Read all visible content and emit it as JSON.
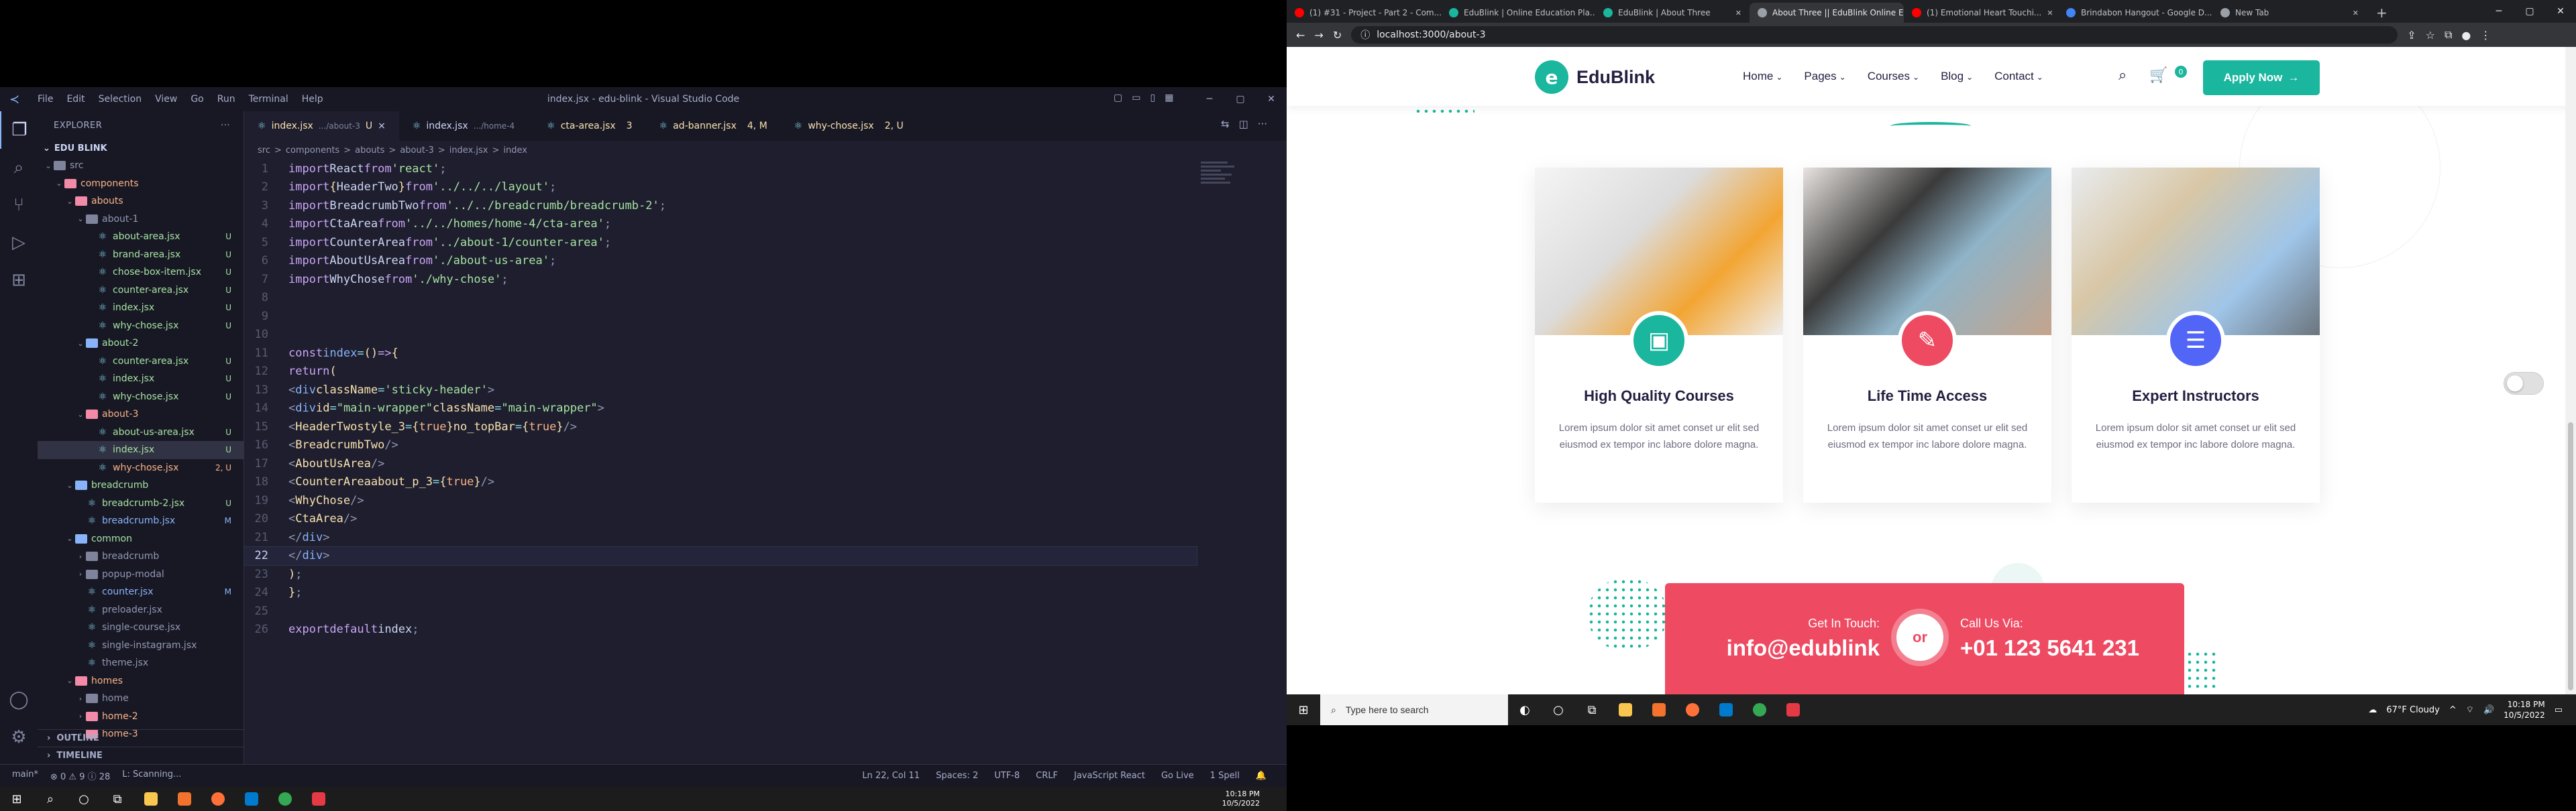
{
  "vscode": {
    "title": "index.jsx - edu-blink - Visual Studio Code",
    "menu": [
      "File",
      "Edit",
      "Selection",
      "View",
      "Go",
      "Run",
      "Terminal",
      "Help"
    ],
    "explorer_label": "EXPLORER",
    "project": "EDU BLINK",
    "tree": [
      {
        "label": "src",
        "depth": 0,
        "type": "folder",
        "open": true,
        "badge": "",
        "color": "c-grey"
      },
      {
        "label": "components",
        "depth": 1,
        "type": "folder",
        "open": true,
        "badge": "",
        "color": "c-orange"
      },
      {
        "label": "abouts",
        "depth": 2,
        "type": "folder",
        "open": true,
        "badge": "",
        "color": "c-orange"
      },
      {
        "label": "about-1",
        "depth": 3,
        "type": "folder",
        "open": true,
        "badge": "",
        "color": "c-grey"
      },
      {
        "label": "about-area.jsx",
        "depth": 4,
        "type": "file",
        "badge": "U",
        "color": "c-green"
      },
      {
        "label": "brand-area.jsx",
        "depth": 4,
        "type": "file",
        "badge": "U",
        "color": "c-green"
      },
      {
        "label": "chose-box-item.jsx",
        "depth": 4,
        "type": "file",
        "badge": "U",
        "color": "c-green"
      },
      {
        "label": "counter-area.jsx",
        "depth": 4,
        "type": "file",
        "badge": "U",
        "color": "c-green"
      },
      {
        "label": "index.jsx",
        "depth": 4,
        "type": "file",
        "badge": "U",
        "color": "c-green"
      },
      {
        "label": "why-chose.jsx",
        "depth": 4,
        "type": "file",
        "badge": "U",
        "color": "c-green"
      },
      {
        "label": "about-2",
        "depth": 3,
        "type": "folder",
        "open": true,
        "badge": "",
        "color": "c-green"
      },
      {
        "label": "counter-area.jsx",
        "depth": 4,
        "type": "file",
        "badge": "U",
        "color": "c-green"
      },
      {
        "label": "index.jsx",
        "depth": 4,
        "type": "file",
        "badge": "U",
        "color": "c-green"
      },
      {
        "label": "why-chose.jsx",
        "depth": 4,
        "type": "file",
        "badge": "U",
        "color": "c-green"
      },
      {
        "label": "about-3",
        "depth": 3,
        "type": "folder",
        "open": true,
        "badge": "",
        "color": "c-orange"
      },
      {
        "label": "about-us-area.jsx",
        "depth": 4,
        "type": "file",
        "badge": "U",
        "color": "c-green"
      },
      {
        "label": "index.jsx",
        "depth": 4,
        "type": "file",
        "badge": "U",
        "color": "c-green",
        "selected": true
      },
      {
        "label": "why-chose.jsx",
        "depth": 4,
        "type": "file",
        "badge": "2, U",
        "color": "c-orange"
      },
      {
        "label": "breadcrumb",
        "depth": 2,
        "type": "folder",
        "open": true,
        "badge": "",
        "color": "c-green"
      },
      {
        "label": "breadcrumb-2.jsx",
        "depth": 3,
        "type": "file",
        "badge": "U",
        "color": "c-green"
      },
      {
        "label": "breadcrumb.jsx",
        "depth": 3,
        "type": "file",
        "badge": "M",
        "color": "c-blue"
      },
      {
        "label": "common",
        "depth": 2,
        "type": "folder",
        "open": true,
        "badge": "",
        "color": "c-green"
      },
      {
        "label": "breadcrumb",
        "depth": 3,
        "type": "folder",
        "open": false,
        "badge": "",
        "color": "c-grey"
      },
      {
        "label": "popup-modal",
        "depth": 3,
        "type": "folder",
        "open": false,
        "badge": "",
        "color": "c-grey"
      },
      {
        "label": "counter.jsx",
        "depth": 3,
        "type": "file",
        "badge": "M",
        "color": "c-blue"
      },
      {
        "label": "preloader.jsx",
        "depth": 3,
        "type": "file",
        "badge": "",
        "color": "c-grey"
      },
      {
        "label": "single-course.jsx",
        "depth": 3,
        "type": "file",
        "badge": "",
        "color": "c-grey"
      },
      {
        "label": "single-instagram.jsx",
        "depth": 3,
        "type": "file",
        "badge": "",
        "color": "c-grey"
      },
      {
        "label": "theme.jsx",
        "depth": 3,
        "type": "file",
        "badge": "",
        "color": "c-grey"
      },
      {
        "label": "homes",
        "depth": 2,
        "type": "folder",
        "open": true,
        "badge": "",
        "color": "c-orange"
      },
      {
        "label": "home",
        "depth": 3,
        "type": "folder",
        "open": false,
        "badge": "",
        "color": "c-grey"
      },
      {
        "label": "home-2",
        "depth": 3,
        "type": "folder",
        "open": false,
        "badge": "",
        "color": "c-orange"
      },
      {
        "label": "home-3",
        "depth": 3,
        "type": "folder",
        "open": false,
        "badge": "",
        "color": "c-orange"
      }
    ],
    "outline": "OUTLINE",
    "timeline": "TIMELINE",
    "tabs": [
      {
        "name": "index.jsx",
        "hint": ".../about-3",
        "badge": "U",
        "active": true
      },
      {
        "name": "index.jsx",
        "hint": ".../home-4",
        "badge": "",
        "active": false
      },
      {
        "name": "cta-area.jsx",
        "hint": "",
        "badge": "3",
        "active": false
      },
      {
        "name": "ad-banner.jsx",
        "hint": "",
        "badge": "4, M",
        "active": false
      },
      {
        "name": "why-chose.jsx",
        "hint": "",
        "badge": "2, U",
        "active": false
      }
    ],
    "breadcrumb": [
      "src",
      ">",
      "components",
      ">",
      "abouts",
      ">",
      "about-3",
      ">",
      "index.jsx",
      ">",
      "index"
    ],
    "status": {
      "branch": "main*",
      "sync": "⊗ 0 ⚠ 9 ⓘ 28",
      "scanning": "L: Scanning...",
      "position": "Ln 22, Col 11",
      "spaces": "Spaces: 2",
      "enc": "UTF-8",
      "eol": "CRLF",
      "lang": "JavaScript React",
      "golive": "Go Live",
      "spell": "1 Spell"
    }
  },
  "taskbar_left": {
    "time": "10:18 PM",
    "date": "10/5/2022"
  },
  "browser": {
    "tabs": [
      {
        "label": "(1) #31 - Project - Part 2 - Com...",
        "color": "#ff0000"
      },
      {
        "label": "EduBlink | Online Education Pla...",
        "color": "#1ab69d"
      },
      {
        "label": "EduBlink | About Three",
        "color": "#1ab69d"
      },
      {
        "label": "About Three || EduBlink Online E...",
        "color": "#9aa0a6",
        "active": true
      },
      {
        "label": "(1) Emotional Heart Touchi...",
        "color": "#ff0000"
      },
      {
        "label": "Brindabon Hangout - Google D...",
        "color": "#4285f4"
      },
      {
        "label": "New Tab",
        "color": "#9aa0a6"
      }
    ],
    "url": "localhost:3000/about-3"
  },
  "site": {
    "logo": "EduBlink",
    "nav": [
      "Home",
      "Pages",
      "Courses",
      "Blog",
      "Contact"
    ],
    "cart_count": "0",
    "apply": "Apply Now",
    "cards": [
      {
        "title": "High Quality Courses",
        "text": "Lorem ipsum dolor sit amet conset ur elit sed eiusmod ex tempor inc labore dolore magna.",
        "color": "#1ab69d",
        "icon": "monitor-icon"
      },
      {
        "title": "Life Time Access",
        "text": "Lorem ipsum dolor sit amet conset ur elit sed eiusmod ex tempor inc labore dolore magna.",
        "color": "#ee4a62",
        "icon": "certificate-icon"
      },
      {
        "title": "Expert Instructors",
        "text": "Lorem ipsum dolor sit amet conset ur elit sed eiusmod ex tempor inc labore dolore magna.",
        "color": "#5165f6",
        "icon": "instructor-icon"
      }
    ],
    "cta": {
      "labelA": "Get In Touch:",
      "valueA": "info@edublink",
      "or": "or",
      "labelB": "Call Us Via:",
      "valueB": "+01 123 5641 231"
    }
  },
  "taskbar_right": {
    "search": "Type here to search",
    "weather": "67°F  Cloudy",
    "time": "10:18 PM",
    "date": "10/5/2022"
  }
}
